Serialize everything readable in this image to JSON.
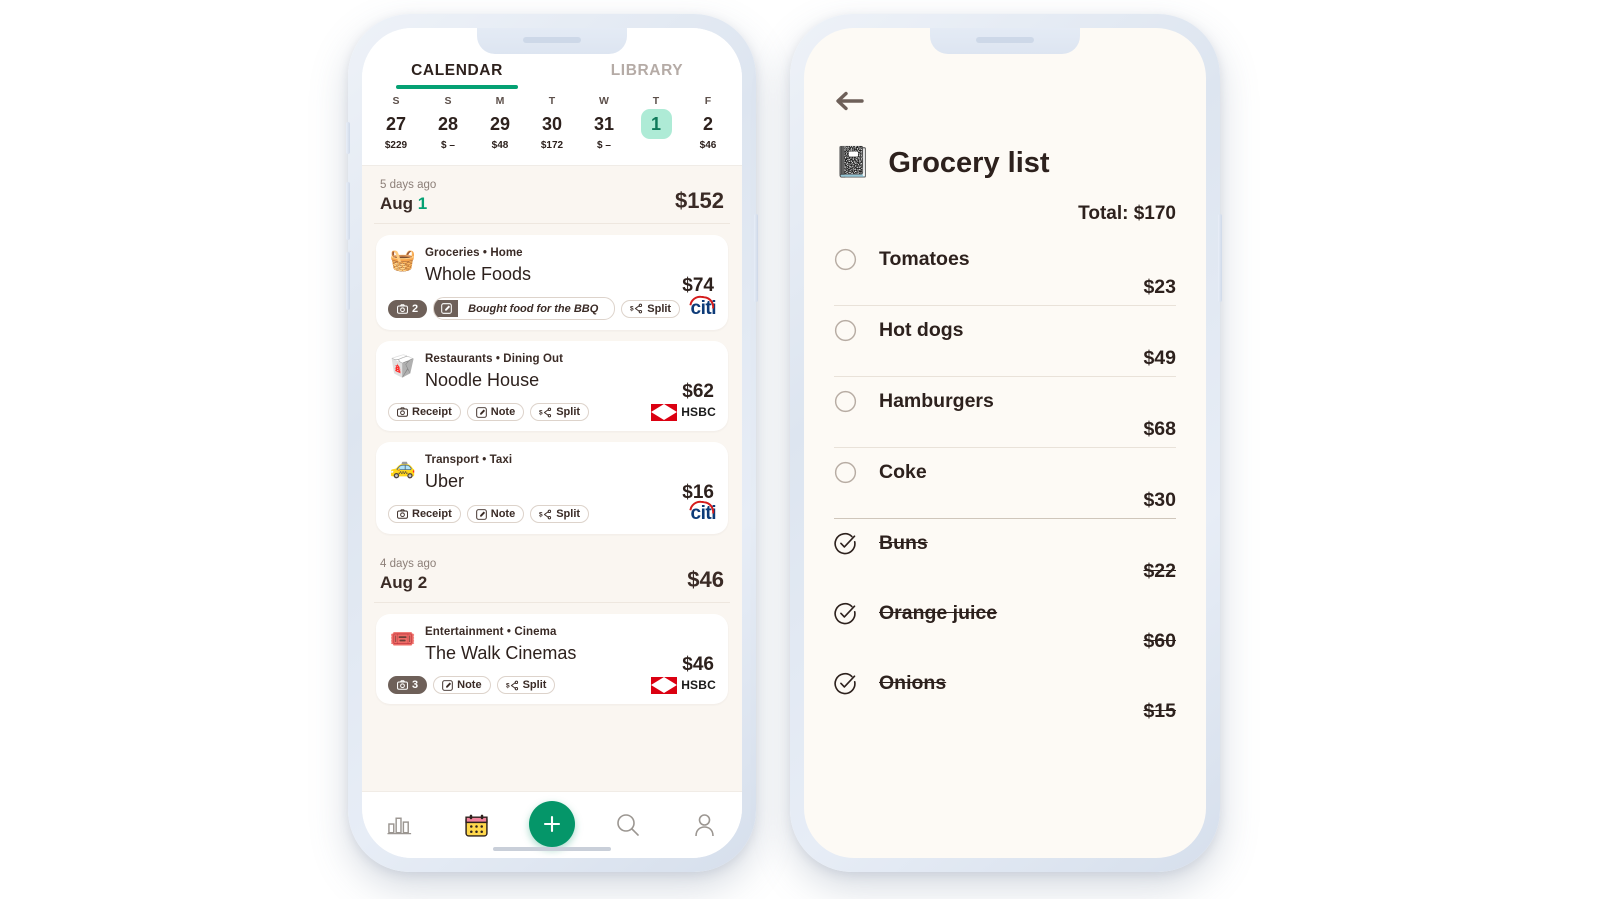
{
  "colors": {
    "accent_green": "#05a173",
    "fab_green": "#059669",
    "selected_day_bg": "#aeebd6",
    "selected_day_text": "#0e7a5a",
    "screen_bg_left": "#ffffff",
    "feed_bg": "#faf6f1",
    "screen_bg_right": "#fdfaf5",
    "text_primary": "#2d211d",
    "text_muted": "#8c7f78",
    "citi_blue": "#0d3b78",
    "citi_red": "#d41b1b",
    "hsbc_red": "#db0011",
    "phone_frame": "#dde5f0"
  },
  "left_phone": {
    "tabs": [
      {
        "label": "CALENDAR",
        "active": true
      },
      {
        "label": "LIBRARY",
        "active": false
      }
    ],
    "date_strip": [
      {
        "dow": "S",
        "day": "27",
        "amount": "$229",
        "selected": false
      },
      {
        "dow": "S",
        "day": "28",
        "amount": "$ –",
        "selected": false
      },
      {
        "dow": "M",
        "day": "29",
        "amount": "$48",
        "selected": false
      },
      {
        "dow": "T",
        "day": "30",
        "amount": "$172",
        "selected": false
      },
      {
        "dow": "W",
        "day": "31",
        "amount": "$ –",
        "selected": false
      },
      {
        "dow": "T",
        "day": "1",
        "amount": "",
        "selected": true
      },
      {
        "dow": "F",
        "day": "2",
        "amount": "$46",
        "selected": false
      }
    ],
    "day_groups": [
      {
        "ago": "5 days ago",
        "month": "Aug",
        "day": "1",
        "total": "$152",
        "transactions": [
          {
            "icon": "🧺",
            "icon_name": "grocery-basket-icon",
            "category": "Groceries • Home",
            "merchant": "Whole Foods",
            "amount": "$74",
            "chips": [
              {
                "type": "photo-count",
                "icon": "camera-icon",
                "label": "2"
              },
              {
                "type": "note-text",
                "icon": "note-icon",
                "label": "Bought food for the BBQ"
              },
              {
                "type": "split",
                "icon": "split-icon",
                "label": "Split"
              }
            ],
            "bank": "citi"
          },
          {
            "icon": "🥡",
            "icon_name": "takeout-box-icon",
            "category": "Restaurants • Dining Out",
            "merchant": "Noodle House",
            "amount": "$62",
            "chips": [
              {
                "type": "plain",
                "icon": "camera-icon",
                "label": "Receipt"
              },
              {
                "type": "plain",
                "icon": "note-icon",
                "label": "Note"
              },
              {
                "type": "split",
                "icon": "split-icon",
                "label": "Split"
              }
            ],
            "bank": "hsbc"
          },
          {
            "icon": "🚕",
            "icon_name": "taxi-icon",
            "category": "Transport • Taxi",
            "merchant": "Uber",
            "amount": "$16",
            "chips": [
              {
                "type": "plain",
                "icon": "camera-icon",
                "label": "Receipt"
              },
              {
                "type": "plain",
                "icon": "note-icon",
                "label": "Note"
              },
              {
                "type": "split",
                "icon": "split-icon",
                "label": "Split"
              }
            ],
            "bank": "citi"
          }
        ]
      },
      {
        "ago": "4 days ago",
        "month": "Aug",
        "day": "2",
        "day_plain": true,
        "total": "$46",
        "transactions": [
          {
            "icon": "🎟️",
            "icon_name": "cinema-ticket-icon",
            "category": "Entertainment • Cinema",
            "merchant": "The Walk Cinemas",
            "amount": "$46",
            "chips": [
              {
                "type": "photo-count",
                "icon": "camera-icon",
                "label": "3"
              },
              {
                "type": "plain",
                "icon": "note-icon",
                "label": "Note"
              },
              {
                "type": "split",
                "icon": "split-icon",
                "label": "Split"
              }
            ],
            "bank": "hsbc"
          }
        ]
      }
    ],
    "bottom_nav": [
      {
        "name": "stats-bars-icon",
        "label": "Stats",
        "active": false
      },
      {
        "name": "calendar-icon",
        "label": "Calendar",
        "active": true
      },
      {
        "name": "add-plus-icon",
        "label": "Add",
        "active": false
      },
      {
        "name": "search-icon",
        "label": "Search",
        "active": false
      },
      {
        "name": "profile-person-icon",
        "label": "Profile",
        "active": false
      }
    ],
    "hsbc_word": "HSBC",
    "citi_word": "citi"
  },
  "right_phone": {
    "back_label": "Back",
    "list_icon": "📓",
    "title": "Grocery list",
    "total_label": "Total: $170",
    "items": [
      {
        "name": "Tomatoes",
        "price": "$23",
        "checked": false
      },
      {
        "name": "Hot dogs",
        "price": "$49",
        "checked": false
      },
      {
        "name": "Hamburgers",
        "price": "$68",
        "checked": false
      },
      {
        "name": "Coke",
        "price": "$30",
        "checked": false
      },
      {
        "name": "Buns",
        "price": "$22",
        "checked": true
      },
      {
        "name": "Orange juice",
        "price": "$60",
        "checked": true
      },
      {
        "name": "Onions",
        "price": "$15",
        "checked": true
      }
    ]
  }
}
